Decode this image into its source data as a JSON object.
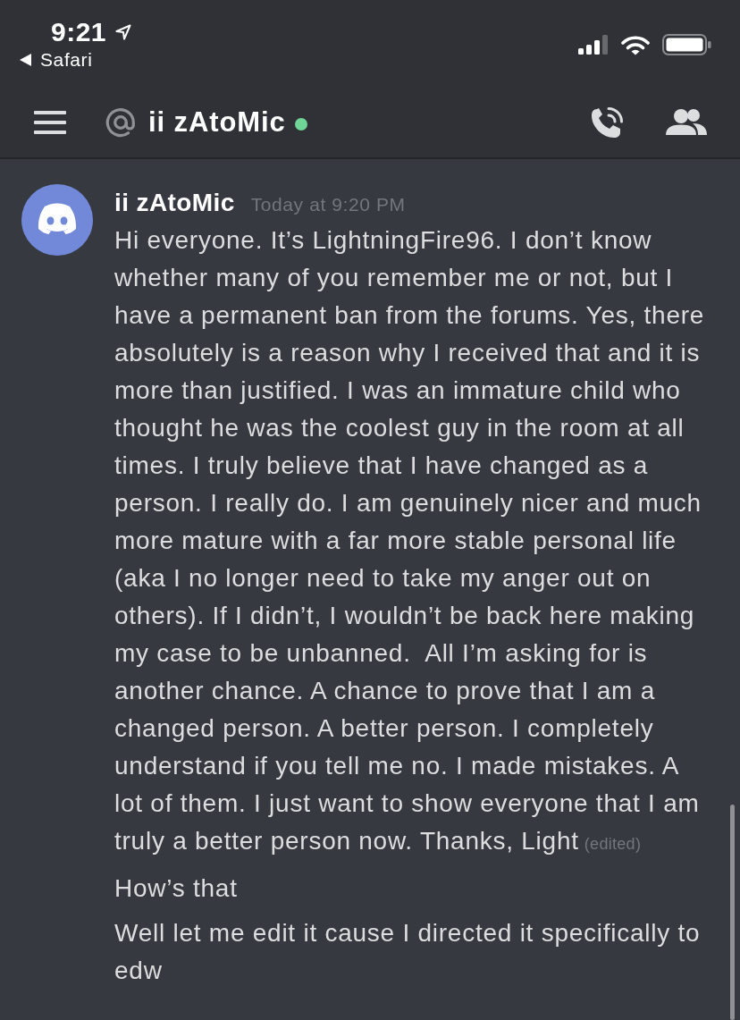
{
  "status_bar": {
    "time": "9:21",
    "back_label": "Safari"
  },
  "header": {
    "title": "ii zAtoMic",
    "online": true
  },
  "messages": [
    {
      "author": "ii zAtoMic",
      "timestamp": "Today at 9:20 PM",
      "paragraphs": [
        {
          "text": "Hi everyone. It’s LightningFire96. I don’t know whether many of you remember me or not, but I have a permanent ban from the forums. Yes, there absolutely is a reason why I received that and it is more than justified. I was an immature child who thought he was the coolest guy in the room at all times. I truly believe that I have changed as a person. I really do. I am genuinely nicer and much more mature with a far more stable personal life (aka I no longer need to take my anger out on others). If I didn’t, I wouldn’t be back here making my case to be unbanned.  All I’m asking for is another chance. A chance to prove that I am a changed person. A better person. I completely understand if you tell me no. I made mistakes. A lot of them. I just want to show everyone that I am truly a better person now. Thanks, Light",
          "edited_label": "(edited)"
        },
        {
          "text": "How’s that"
        },
        {
          "text": "Well let me edit it cause I directed it specifically to edw"
        }
      ]
    }
  ]
}
